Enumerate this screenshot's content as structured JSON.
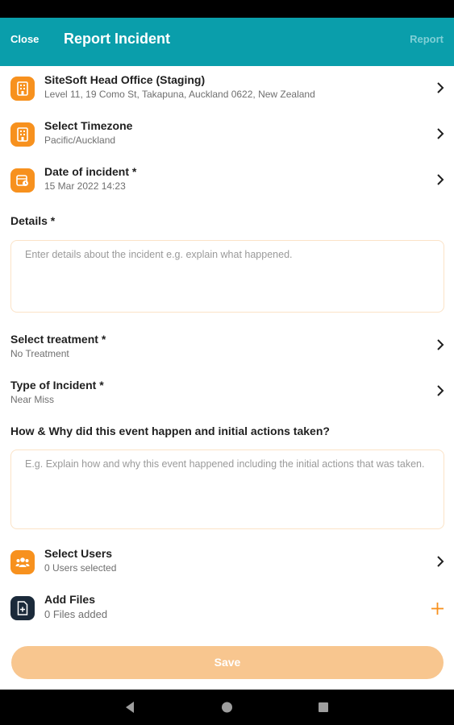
{
  "app_bar": {
    "close_label": "Close",
    "title": "Report Incident",
    "report_label": "Report"
  },
  "location": {
    "icon": "building-icon",
    "label": "SiteSoft Head Office (Staging)",
    "sub": "Level 11, 19 Como St, Takapuna, Auckland 0622, New Zealand"
  },
  "timezone": {
    "icon": "building-icon",
    "label": "Select Timezone",
    "sub": "Pacific/Auckland"
  },
  "date": {
    "icon": "calendar-clock-icon",
    "label": "Date of incident *",
    "sub": "15 Mar 2022 14:23"
  },
  "details": {
    "label": "Details *",
    "placeholder": "Enter details about the incident e.g. explain what happened."
  },
  "treatment": {
    "label": "Select treatment *",
    "sub": "No Treatment"
  },
  "incident_type": {
    "label": "Type of Incident *",
    "sub": "Near Miss"
  },
  "how_why": {
    "label": "How & Why did this event happen and initial actions taken?",
    "placeholder": "E.g. Explain how and why this event happened including the initial actions that was taken."
  },
  "users": {
    "icon": "users-icon",
    "label": "Select Users",
    "sub": "0 Users selected"
  },
  "files": {
    "icon": "file-add-icon",
    "label": "Add Files",
    "sub": "0 Files added"
  },
  "save_label": "Save",
  "colors": {
    "header": "#0a9eab",
    "accent": "#f7911e",
    "save_button_disabled": "#f8c68f"
  }
}
